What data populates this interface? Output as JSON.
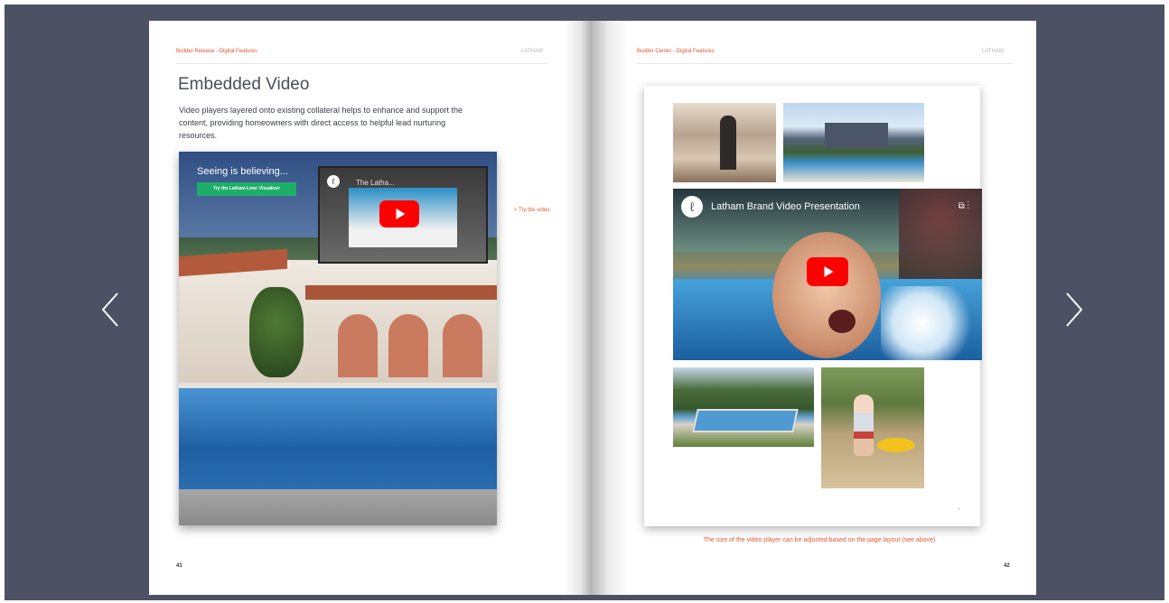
{
  "nav": {
    "prev_glyph": "‹",
    "next_glyph": "›"
  },
  "left_page": {
    "running_head": "Builder Release - Digital Features",
    "running_right": "LATHAM",
    "title": "Embedded Video",
    "intro": "Video players layered onto existing collateral helps to enhance and support the content, providing homeowners with direct access to helpful lead nurturing resources.",
    "brochure": {
      "tagline": "Seeing is believing...",
      "cta_label": "Try the Latham Liner Visualizer",
      "player_logo": "ℓ",
      "player_title": "The Latha..."
    },
    "try_note": "< Try the video",
    "page_number": "41"
  },
  "right_page": {
    "running_head": "Builder Center - Digital Features",
    "running_right": "LATHAM",
    "video": {
      "logo": "ℓ",
      "title": "Latham Brand Video Presentation",
      "icons": "⧉  ⋮"
    },
    "card_page_number": "•",
    "size_note": "The size of the video player can be adjusted based on the page layout (see above)",
    "page_number": "42"
  },
  "colors": {
    "background": "#4c5163",
    "accent": "#e4572e",
    "youtube_red": "#ff0000",
    "cta_green": "#1fae6a"
  }
}
